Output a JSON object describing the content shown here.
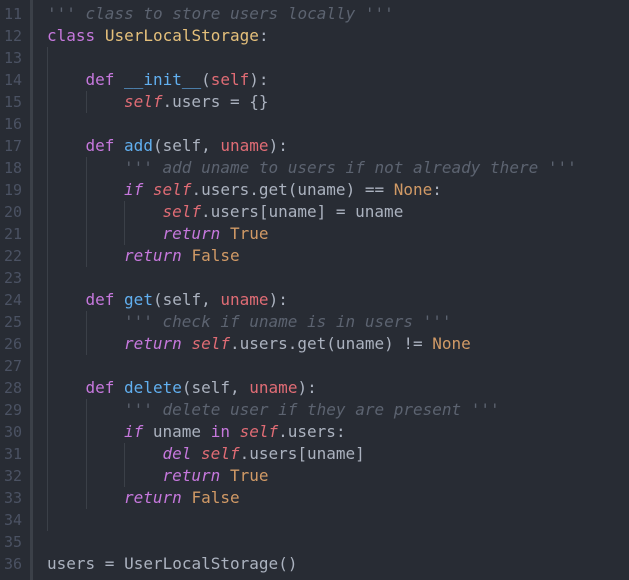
{
  "theme": {
    "background": "#282c34",
    "line_number_color": "#4b5263",
    "keyword": "#c678dd",
    "self": "#e06c75",
    "class_name": "#e5c07b",
    "function": "#61afef",
    "constant": "#d19a66",
    "comment": "#5c6370",
    "text": "#abb2bf"
  },
  "editor": {
    "line_numbers": [
      "11",
      "12",
      "13",
      "14",
      "15",
      "16",
      "17",
      "18",
      "19",
      "20",
      "21",
      "22",
      "23",
      "24",
      "25",
      "26",
      "27",
      "28",
      "29",
      "30",
      "31",
      "32",
      "33",
      "34",
      "35",
      "36"
    ],
    "lines": [
      {
        "indent": 0,
        "tokens": [
          {
            "t": "''' class to store users locally '''",
            "c": "cmt"
          }
        ]
      },
      {
        "indent": 0,
        "tokens": [
          {
            "t": "class",
            "c": "kw"
          },
          {
            "t": " ",
            "c": "plain"
          },
          {
            "t": "UserLocalStorage",
            "c": "cls"
          },
          {
            "t": ":",
            "c": "plain"
          }
        ]
      },
      {
        "indent": 0,
        "tokens": []
      },
      {
        "indent": 1,
        "tokens": [
          {
            "t": "def",
            "c": "kw"
          },
          {
            "t": " ",
            "c": "plain"
          },
          {
            "t": "__init__",
            "c": "dunder"
          },
          {
            "t": "(",
            "c": "plain"
          },
          {
            "t": "self",
            "c": "param"
          },
          {
            "t": "):",
            "c": "plain"
          }
        ]
      },
      {
        "indent": 2,
        "tokens": [
          {
            "t": "self",
            "c": "self"
          },
          {
            "t": ".users = {}",
            "c": "plain"
          }
        ]
      },
      {
        "indent": 0,
        "tokens": []
      },
      {
        "indent": 1,
        "tokens": [
          {
            "t": "def",
            "c": "kw"
          },
          {
            "t": " ",
            "c": "plain"
          },
          {
            "t": "add",
            "c": "fn"
          },
          {
            "t": "(self, ",
            "c": "plain"
          },
          {
            "t": "uname",
            "c": "param"
          },
          {
            "t": "):",
            "c": "plain"
          }
        ]
      },
      {
        "indent": 2,
        "tokens": [
          {
            "t": "''' add uname to users if not already there '''",
            "c": "cmt"
          }
        ]
      },
      {
        "indent": 2,
        "tokens": [
          {
            "t": "if",
            "c": "kwi"
          },
          {
            "t": " ",
            "c": "plain"
          },
          {
            "t": "self",
            "c": "self"
          },
          {
            "t": ".users.get(uname) == ",
            "c": "plain"
          },
          {
            "t": "None",
            "c": "const"
          },
          {
            "t": ":",
            "c": "plain"
          }
        ]
      },
      {
        "indent": 3,
        "tokens": [
          {
            "t": "self",
            "c": "self"
          },
          {
            "t": ".users[uname] = uname",
            "c": "plain"
          }
        ]
      },
      {
        "indent": 3,
        "tokens": [
          {
            "t": "return",
            "c": "kwi"
          },
          {
            "t": " ",
            "c": "plain"
          },
          {
            "t": "True",
            "c": "const"
          }
        ]
      },
      {
        "indent": 2,
        "tokens": [
          {
            "t": "return",
            "c": "kwi"
          },
          {
            "t": " ",
            "c": "plain"
          },
          {
            "t": "False",
            "c": "const"
          }
        ]
      },
      {
        "indent": 0,
        "tokens": []
      },
      {
        "indent": 1,
        "tokens": [
          {
            "t": "def",
            "c": "kw"
          },
          {
            "t": " ",
            "c": "plain"
          },
          {
            "t": "get",
            "c": "fn"
          },
          {
            "t": "(self, ",
            "c": "plain"
          },
          {
            "t": "uname",
            "c": "param"
          },
          {
            "t": "):",
            "c": "plain"
          }
        ]
      },
      {
        "indent": 2,
        "tokens": [
          {
            "t": "''' check if uname is in users '''",
            "c": "cmt"
          }
        ]
      },
      {
        "indent": 2,
        "tokens": [
          {
            "t": "return",
            "c": "kwi"
          },
          {
            "t": " ",
            "c": "plain"
          },
          {
            "t": "self",
            "c": "self"
          },
          {
            "t": ".users.get(uname) != ",
            "c": "plain"
          },
          {
            "t": "None",
            "c": "const"
          }
        ]
      },
      {
        "indent": 0,
        "tokens": []
      },
      {
        "indent": 1,
        "tokens": [
          {
            "t": "def",
            "c": "kw"
          },
          {
            "t": " ",
            "c": "plain"
          },
          {
            "t": "delete",
            "c": "fn"
          },
          {
            "t": "(self, ",
            "c": "plain"
          },
          {
            "t": "uname",
            "c": "param"
          },
          {
            "t": "):",
            "c": "plain"
          }
        ]
      },
      {
        "indent": 2,
        "tokens": [
          {
            "t": "''' delete user if they are present '''",
            "c": "cmt"
          }
        ]
      },
      {
        "indent": 2,
        "tokens": [
          {
            "t": "if",
            "c": "kwi"
          },
          {
            "t": " uname ",
            "c": "plain"
          },
          {
            "t": "in",
            "c": "kw"
          },
          {
            "t": " ",
            "c": "plain"
          },
          {
            "t": "self",
            "c": "self"
          },
          {
            "t": ".users:",
            "c": "plain"
          }
        ]
      },
      {
        "indent": 3,
        "tokens": [
          {
            "t": "del",
            "c": "kwi"
          },
          {
            "t": " ",
            "c": "plain"
          },
          {
            "t": "self",
            "c": "self"
          },
          {
            "t": ".users[uname]",
            "c": "plain"
          }
        ]
      },
      {
        "indent": 3,
        "tokens": [
          {
            "t": "return",
            "c": "kwi"
          },
          {
            "t": " ",
            "c": "plain"
          },
          {
            "t": "True",
            "c": "const"
          }
        ]
      },
      {
        "indent": 2,
        "tokens": [
          {
            "t": "return",
            "c": "kwi"
          },
          {
            "t": " ",
            "c": "plain"
          },
          {
            "t": "False",
            "c": "const"
          }
        ]
      },
      {
        "indent": 0,
        "tokens": []
      },
      {
        "indent": 0,
        "tokens": []
      },
      {
        "indent": 0,
        "tokens": [
          {
            "t": "users = UserLocalStorage()",
            "c": "plain"
          }
        ]
      }
    ]
  }
}
